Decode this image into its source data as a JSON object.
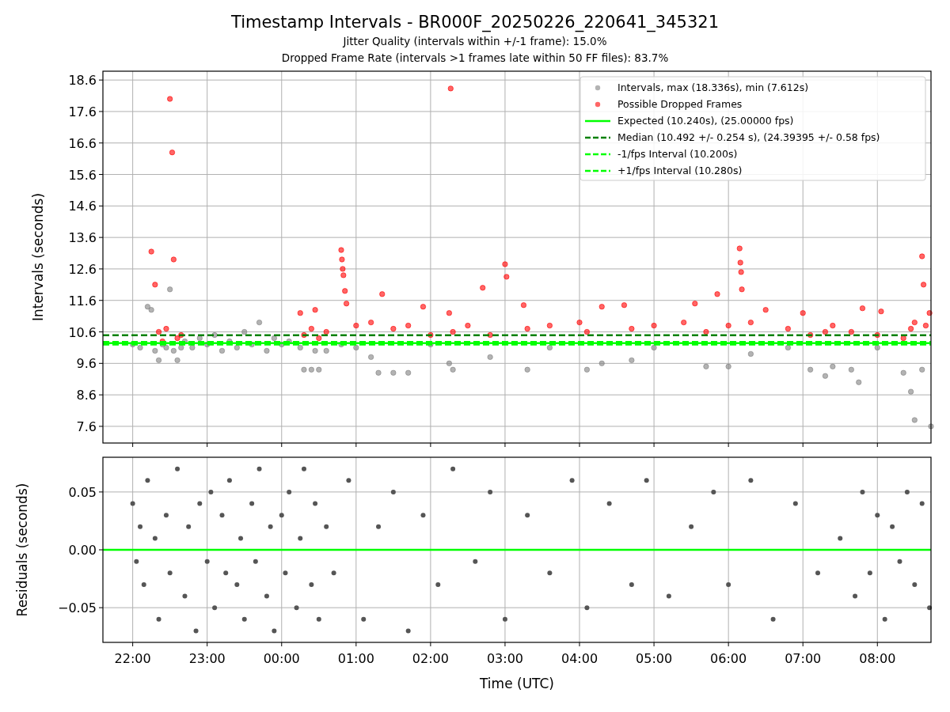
{
  "figure": {
    "title": "Timestamp Intervals - BR000F_20250226_220641_345321",
    "subtitles": [
      "Jitter Quality (intervals within +/-1 frame): 15.0%",
      "Dropped Frame Rate (intervals >1 frames late within 50 FF files): 83.7%"
    ]
  },
  "intervals_chart": {
    "chart_data": {
      "type": "scatter",
      "ylabel": "Intervals (seconds)",
      "grid": true,
      "legend": "upper right",
      "xlim": [
        "2025-02-26T21:36",
        "2025-02-27T08:43:12"
      ],
      "ylim": [
        7.07,
        18.88
      ],
      "yticks": [
        7.6,
        8.6,
        9.6,
        10.6,
        11.6,
        12.6,
        13.6,
        14.6,
        15.6,
        16.6,
        17.6,
        18.6
      ],
      "x": [
        "2025-02-26T22:00",
        "2025-02-26T22:06",
        "2025-02-26T22:12",
        "2025-02-26T22:15",
        "2025-02-26T22:18",
        "2025-02-26T22:21",
        "2025-02-26T22:24",
        "2025-02-26T22:27",
        "2025-02-26T22:30",
        "2025-02-26T22:31:48",
        "2025-02-26T22:33",
        "2025-02-26T22:36",
        "2025-02-26T22:39",
        "2025-02-26T22:42",
        "2025-02-26T22:48",
        "2025-02-26T22:54",
        "2025-02-26T23:00",
        "2025-02-26T23:06",
        "2025-02-26T23:12",
        "2025-02-26T23:18",
        "2025-02-26T23:24",
        "2025-02-26T23:30",
        "2025-02-26T23:36",
        "2025-02-26T23:42",
        "2025-02-26T23:48",
        "2025-02-26T23:54",
        "2025-02-27T00:00",
        "2025-02-27T00:06",
        "2025-02-27T00:15",
        "2025-02-27T00:18",
        "2025-02-27T00:24",
        "2025-02-27T00:27",
        "2025-02-27T00:30",
        "2025-02-27T00:36",
        "2025-02-27T00:48",
        "2025-02-27T00:48:36",
        "2025-02-27T00:49:12",
        "2025-02-27T00:49:48",
        "2025-02-27T00:51",
        "2025-02-27T00:52:12",
        "2025-02-27T01:00",
        "2025-02-27T01:12",
        "2025-02-27T01:18",
        "2025-02-27T01:21",
        "2025-02-27T01:30",
        "2025-02-27T01:42",
        "2025-02-27T01:54",
        "2025-02-27T02:00",
        "2025-02-27T02:15",
        "2025-02-27T02:16:12",
        "2025-02-27T02:18",
        "2025-02-27T02:30",
        "2025-02-27T02:42",
        "2025-02-27T02:48",
        "2025-02-27T03:00",
        "2025-02-27T03:01:12",
        "2025-02-27T03:15",
        "2025-02-27T03:18",
        "2025-02-27T03:36",
        "2025-02-27T04:00",
        "2025-02-27T04:06",
        "2025-02-27T04:18",
        "2025-02-27T04:36",
        "2025-02-27T04:42",
        "2025-02-27T05:00",
        "2025-02-27T05:24",
        "2025-02-27T05:33",
        "2025-02-27T05:42",
        "2025-02-27T05:51",
        "2025-02-27T06:00",
        "2025-02-27T06:09",
        "2025-02-27T06:09:36",
        "2025-02-27T06:10:12",
        "2025-02-27T06:10:48",
        "2025-02-27T06:18",
        "2025-02-27T06:30",
        "2025-02-27T06:48",
        "2025-02-27T07:00",
        "2025-02-27T07:06",
        "2025-02-27T07:18",
        "2025-02-27T07:24",
        "2025-02-27T07:39",
        "2025-02-27T07:45",
        "2025-02-27T07:48",
        "2025-02-27T08:00",
        "2025-02-27T08:03",
        "2025-02-27T08:21",
        "2025-02-27T08:27",
        "2025-02-27T08:30",
        "2025-02-27T08:36",
        "2025-02-27T08:37:12",
        "2025-02-27T08:39",
        "2025-02-27T08:42",
        "2025-02-27T08:43:12"
      ],
      "series": [
        {
          "name": "Intervals, max (18.336s), min (7.612s)",
          "color": "#808080",
          "values": [
            10.2,
            10.1,
            11.4,
            11.3,
            10.0,
            9.7,
            10.2,
            10.1,
            11.95,
            null,
            10.0,
            9.7,
            10.1,
            10.3,
            10.1,
            10.4,
            10.2,
            10.5,
            10.0,
            10.3,
            10.1,
            10.6,
            10.2,
            10.9,
            10.0,
            10.4,
            10.2,
            10.3,
            10.1,
            9.4,
            9.4,
            10.0,
            9.4,
            10.0,
            10.2,
            null,
            null,
            null,
            null,
            null,
            10.1,
            9.8,
            9.3,
            null,
            9.3,
            9.3,
            null,
            10.2,
            9.6,
            null,
            9.4,
            null,
            null,
            9.8,
            null,
            null,
            null,
            9.4,
            10.1,
            null,
            9.4,
            9.6,
            null,
            9.7,
            10.1,
            null,
            null,
            9.5,
            null,
            9.5,
            null,
            null,
            null,
            null,
            9.9,
            null,
            10.1,
            null,
            9.4,
            9.2,
            9.5,
            9.4,
            9.0,
            null,
            10.1,
            null,
            9.3,
            8.7,
            7.8,
            9.4,
            null,
            null,
            null,
            7.6
          ]
        },
        {
          "name": "Possible Dropped Frames",
          "color": "#ff0000",
          "values": [
            null,
            null,
            null,
            13.15,
            12.1,
            10.6,
            10.3,
            10.7,
            18.0,
            16.3,
            12.9,
            10.4,
            10.5,
            null,
            null,
            null,
            null,
            null,
            null,
            null,
            null,
            null,
            null,
            null,
            null,
            null,
            null,
            null,
            11.2,
            10.5,
            10.7,
            11.3,
            10.4,
            10.6,
            13.2,
            12.9,
            12.6,
            12.4,
            11.9,
            11.5,
            10.8,
            10.9,
            null,
            11.8,
            10.7,
            10.8,
            11.4,
            10.5,
            11.2,
            18.33,
            10.6,
            10.8,
            12.0,
            10.5,
            12.75,
            12.35,
            11.45,
            10.7,
            10.8,
            10.9,
            10.6,
            11.4,
            11.45,
            10.7,
            10.8,
            10.9,
            11.5,
            10.6,
            11.8,
            10.8,
            13.25,
            12.8,
            12.5,
            11.95,
            10.9,
            11.3,
            10.7,
            11.2,
            10.5,
            10.6,
            10.8,
            10.6,
            null,
            11.35,
            10.5,
            11.25,
            10.4,
            10.7,
            10.9,
            13.0,
            12.1,
            10.8,
            11.2,
            null
          ]
        }
      ],
      "ref_lines": [
        {
          "axis": "y",
          "value": 10.24,
          "label": "Expected (10.240s), (25.00000 fps)",
          "color": "#00ff00"
        },
        {
          "axis": "y",
          "value": 10.492,
          "label": "Median (10.492 +/- 0.254 s), (24.39395 +/- 0.58 fps)",
          "color": "#008000"
        },
        {
          "axis": "y",
          "value": 10.2,
          "label": "-1/fps Interval (10.200s)",
          "color": "#00ff00"
        },
        {
          "axis": "y",
          "value": 10.28,
          "label": "+1/fps Interval (10.280s)",
          "color": "#00ff00"
        }
      ]
    }
  },
  "residuals_chart": {
    "chart_data": {
      "type": "scatter",
      "xlabel": "Time (UTC)",
      "ylabel": "Residuals (seconds)",
      "grid": true,
      "xlim": [
        "2025-02-26T21:36",
        "2025-02-27T08:43:12"
      ],
      "ylim": [
        -0.08,
        0.08
      ],
      "xticks": [
        {
          "value": "2025-02-26T22:00",
          "label": "22:00"
        },
        {
          "value": "2025-02-26T23:00",
          "label": "23:00"
        },
        {
          "value": "2025-02-27T00:00",
          "label": "00:00"
        },
        {
          "value": "2025-02-27T01:00",
          "label": "01:00"
        },
        {
          "value": "2025-02-27T02:00",
          "label": "02:00"
        },
        {
          "value": "2025-02-27T03:00",
          "label": "03:00"
        },
        {
          "value": "2025-02-27T04:00",
          "label": "04:00"
        },
        {
          "value": "2025-02-27T05:00",
          "label": "05:00"
        },
        {
          "value": "2025-02-27T06:00",
          "label": "06:00"
        },
        {
          "value": "2025-02-27T07:00",
          "label": "07:00"
        },
        {
          "value": "2025-02-27T08:00",
          "label": "08:00"
        }
      ],
      "yticks": [
        {
          "value": -0.05,
          "label": "−0.05"
        },
        {
          "value": 0,
          "label": "0.00"
        },
        {
          "value": 0.05,
          "label": "0.05"
        }
      ],
      "x": [
        "2025-02-26T22:00",
        "2025-02-26T22:03",
        "2025-02-26T22:06",
        "2025-02-26T22:09",
        "2025-02-26T22:12",
        "2025-02-26T22:18",
        "2025-02-26T22:21",
        "2025-02-26T22:27",
        "2025-02-26T22:30",
        "2025-02-26T22:36",
        "2025-02-26T22:42",
        "2025-02-26T22:45",
        "2025-02-26T22:51",
        "2025-02-26T22:54",
        "2025-02-26T23:00",
        "2025-02-26T23:03",
        "2025-02-26T23:06",
        "2025-02-26T23:12",
        "2025-02-26T23:15",
        "2025-02-26T23:18",
        "2025-02-26T23:24",
        "2025-02-26T23:27",
        "2025-02-26T23:30",
        "2025-02-26T23:36",
        "2025-02-26T23:39",
        "2025-02-26T23:42",
        "2025-02-26T23:48",
        "2025-02-26T23:51",
        "2025-02-26T23:54",
        "2025-02-27T00:00",
        "2025-02-27T00:03",
        "2025-02-27T00:06",
        "2025-02-27T00:12",
        "2025-02-27T00:15",
        "2025-02-27T00:18",
        "2025-02-27T00:24",
        "2025-02-27T00:27",
        "2025-02-27T00:30",
        "2025-02-27T00:36",
        "2025-02-27T00:42",
        "2025-02-27T00:54",
        "2025-02-27T01:06",
        "2025-02-27T01:18",
        "2025-02-27T01:30",
        "2025-02-27T01:42",
        "2025-02-27T01:54",
        "2025-02-27T02:06",
        "2025-02-27T02:18",
        "2025-02-27T02:36",
        "2025-02-27T02:48",
        "2025-02-27T03:00",
        "2025-02-27T03:18",
        "2025-02-27T03:36",
        "2025-02-27T03:54",
        "2025-02-27T04:06",
        "2025-02-27T04:24",
        "2025-02-27T04:42",
        "2025-02-27T04:54",
        "2025-02-27T05:12",
        "2025-02-27T05:30",
        "2025-02-27T05:48",
        "2025-02-27T06:00",
        "2025-02-27T06:18",
        "2025-02-27T06:36",
        "2025-02-27T06:54",
        "2025-02-27T07:12",
        "2025-02-27T07:30",
        "2025-02-27T07:42",
        "2025-02-27T07:48",
        "2025-02-27T07:54",
        "2025-02-27T08:00",
        "2025-02-27T08:06",
        "2025-02-27T08:12",
        "2025-02-27T08:18",
        "2025-02-27T08:24",
        "2025-02-27T08:30",
        "2025-02-27T08:36",
        "2025-02-27T08:42"
      ],
      "series": [
        {
          "color": "#555555",
          "values": [
            0.04,
            -0.01,
            0.02,
            -0.03,
            0.06,
            0.01,
            -0.06,
            0.03,
            -0.02,
            0.07,
            -0.04,
            0.02,
            -0.07,
            0.04,
            -0.01,
            0.05,
            -0.05,
            0.03,
            -0.02,
            0.06,
            -0.03,
            0.01,
            -0.06,
            0.04,
            -0.01,
            0.07,
            -0.04,
            0.02,
            -0.07,
            0.03,
            -0.02,
            0.05,
            -0.05,
            0.01,
            0.07,
            -0.03,
            0.04,
            -0.06,
            0.02,
            -0.02,
            0.06,
            -0.06,
            0.02,
            0.05,
            -0.07,
            0.03,
            -0.03,
            0.07,
            -0.01,
            0.05,
            -0.06,
            0.03,
            -0.02,
            0.06,
            -0.05,
            0.04,
            -0.03,
            0.06,
            -0.04,
            0.02,
            0.05,
            -0.03,
            0.06,
            -0.06,
            0.04,
            -0.02,
            0.01,
            -0.04,
            0.05,
            -0.02,
            0.03,
            -0.06,
            0.02,
            -0.01,
            0.05,
            -0.03,
            0.04,
            -0.05
          ]
        }
      ],
      "ref_lines": [
        {
          "axis": "y",
          "value": 0,
          "color": "#00ff00"
        }
      ]
    }
  }
}
